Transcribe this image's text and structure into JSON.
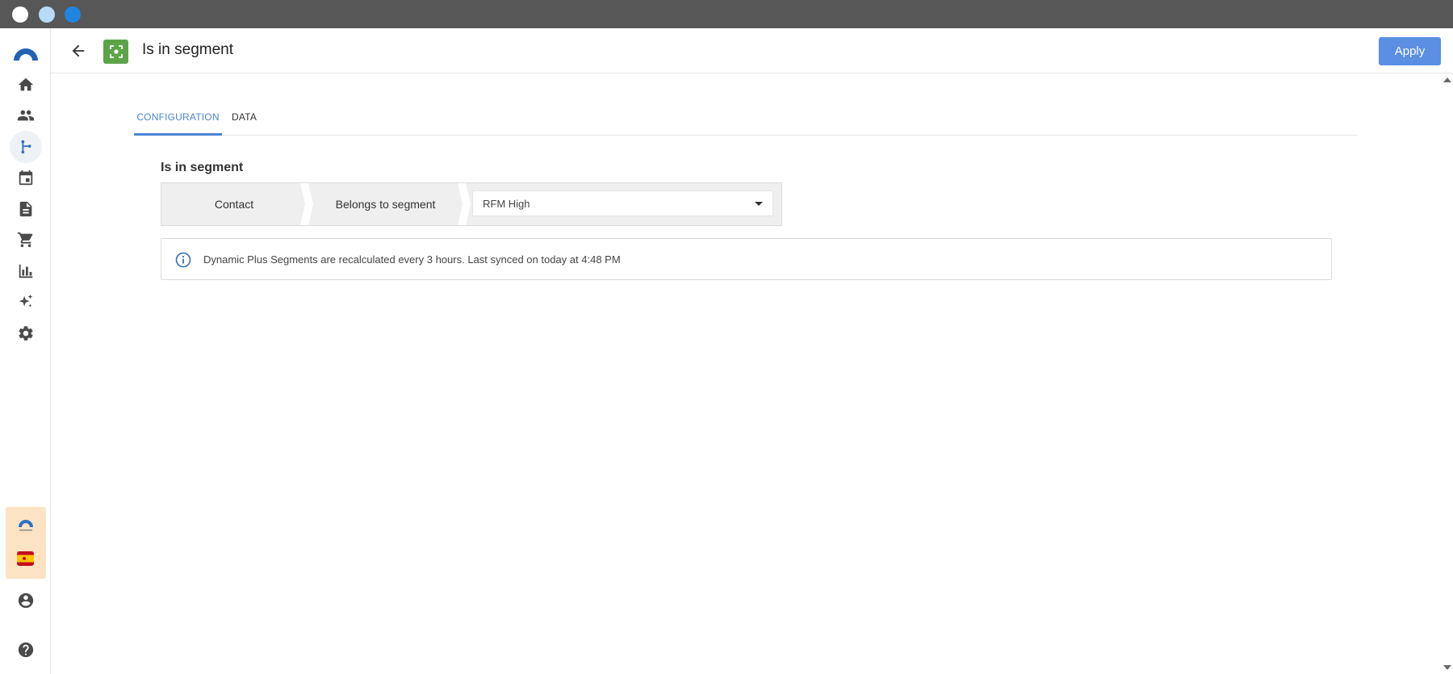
{
  "header": {
    "title": "Is in segment",
    "apply_label": "Apply"
  },
  "sidebar": {
    "items": [
      {
        "icon": "home-icon"
      },
      {
        "icon": "people-icon"
      },
      {
        "icon": "flow-icon",
        "active": true
      },
      {
        "icon": "calendar-icon"
      },
      {
        "icon": "document-icon"
      },
      {
        "icon": "cart-icon"
      },
      {
        "icon": "bar-chart-icon"
      },
      {
        "icon": "sparkle-icon"
      },
      {
        "icon": "gear-icon"
      }
    ],
    "bottom": [
      "account-icon",
      "help-icon"
    ]
  },
  "tabs": [
    {
      "label": "CONFIGURATION",
      "active": true
    },
    {
      "label": "DATA",
      "active": false
    }
  ],
  "section": {
    "title": "Is in segment",
    "crumbs": [
      "Contact",
      "Belongs to segment"
    ],
    "segment_select": {
      "value": "RFM High"
    }
  },
  "info": {
    "text": "Dynamic Plus Segments are recalculated every 3 hours. Last synced on today at 4:48 PM"
  },
  "colors": {
    "accent": "#4a84d6",
    "apply": "#5b8fe4",
    "segment_badge": "#5da449",
    "titlebar": "#575757"
  }
}
